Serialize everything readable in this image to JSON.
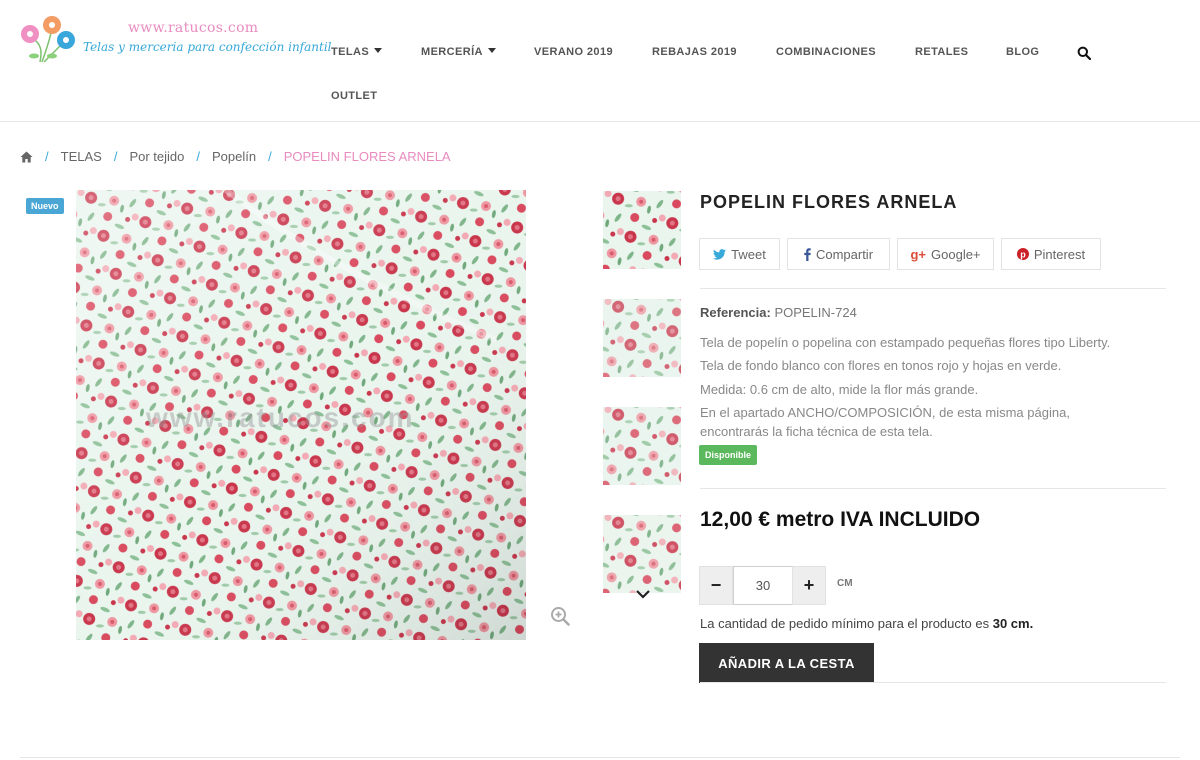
{
  "header": {
    "logo_url": "www.ratucos.com",
    "logo_tagline": "Telas y merceria para confección infantil",
    "nav": [
      {
        "label": "TELAS",
        "dropdown": true
      },
      {
        "label": "MERCERÍA",
        "dropdown": true
      },
      {
        "label": "VERANO 2019",
        "dropdown": false
      },
      {
        "label": "REBAJAS 2019",
        "dropdown": false
      },
      {
        "label": "COMBINACIONES",
        "dropdown": false
      },
      {
        "label": "RETALES",
        "dropdown": false
      },
      {
        "label": "BLOG",
        "dropdown": false
      },
      {
        "label": "OUTLET",
        "dropdown": false
      }
    ],
    "search_icon": "search-icon"
  },
  "breadcrumb": {
    "separator": "/",
    "items": [
      "TELAS",
      "Por tejido",
      "Popelín"
    ],
    "current": "POPELIN FLORES ARNELA"
  },
  "gallery": {
    "badge_new": "Nuevo",
    "watermark": "www.ratucos.com"
  },
  "product": {
    "title": "POPELIN FLORES ARNELA",
    "share": {
      "tweet": "Tweet",
      "facebook": "Compartir",
      "google": "Google+",
      "pinterest": "Pinterest"
    },
    "reference_label": "Referencia:",
    "reference_value": "POPELIN-724",
    "description": [
      "Tela de popelín o popelina con estampado pequeñas flores tipo Liberty.",
      "Tela de fondo blanco con flores en tonos rojo y hojas en verde.",
      "Medida: 0.6 cm de alto, mide la flor más grande.",
      "En el apartado ANCHO/COMPOSICIÓN, de esta misma página,",
      "encontrarás la ficha técnica de esta tela."
    ],
    "availability": "Disponible",
    "price": "12,00 € metro IVA INCLUIDO",
    "quantity": {
      "minus": "−",
      "value": "30",
      "plus": "+",
      "unit": "CM"
    },
    "min_note_prefix": "La cantidad de pedido mínimo para el producto es",
    "min_note_value": "30 cm.",
    "add_to_cart": "AÑADIR A LA CESTA"
  },
  "colors": {
    "accent_blue": "#38a9d9",
    "accent_pink": "#e98bbf",
    "badge_green": "#5cb85c",
    "button_dark": "#333333"
  }
}
